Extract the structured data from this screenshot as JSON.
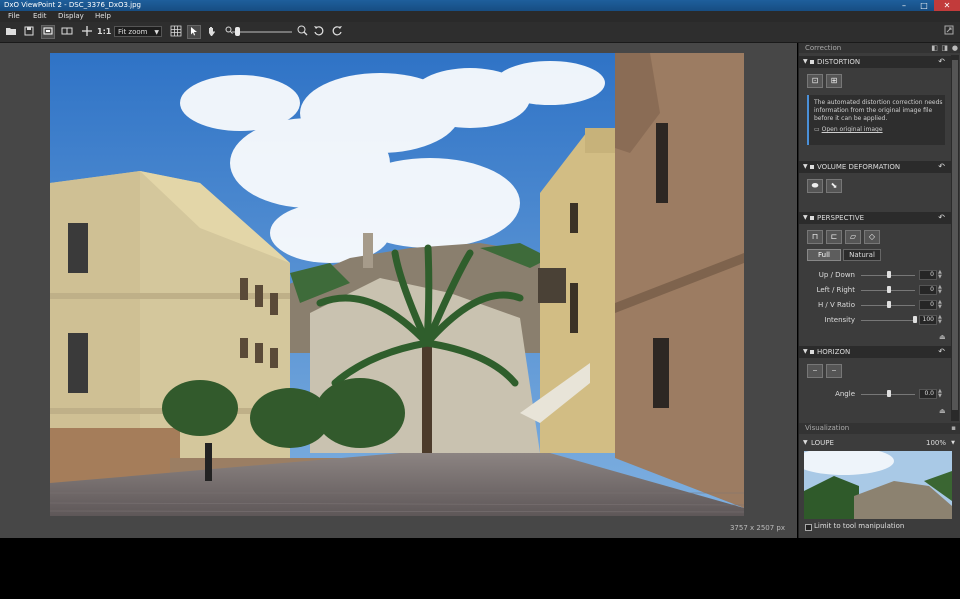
{
  "window": {
    "title": "DxO ViewPoint 2 - DSC_3376_DxO3.jpg",
    "minimize": "–",
    "maximize": "□",
    "close": "✕"
  },
  "menu": [
    "File",
    "Edit",
    "Display",
    "Help"
  ],
  "toolbar": {
    "one_to_one": "1:1",
    "zoom_select": "Fit zoom",
    "zoom_level": 0.05
  },
  "image": {
    "dimensions": "3757 x 2507 px"
  },
  "panel": {
    "title": "Correction",
    "distortion": {
      "title": "DISTORTION",
      "info": [
        "The automated distortion correction needs",
        "information from the original image file",
        "before it can be applied."
      ],
      "link": "Open original image"
    },
    "volume": {
      "title": "VOLUME DEFORMATION"
    },
    "perspective": {
      "title": "PERSPECTIVE",
      "mode_full": "Full",
      "mode_natural": "Natural",
      "sliders": [
        {
          "label": "Up / Down",
          "value": "0",
          "level": 0.5
        },
        {
          "label": "Left / Right",
          "value": "0",
          "level": 0.5
        },
        {
          "label": "H / V Ratio",
          "value": "0",
          "level": 0.5
        },
        {
          "label": "Intensity",
          "value": "100",
          "level": 1.0
        }
      ]
    },
    "horizon": {
      "title": "HORIZON",
      "slider": {
        "label": "Angle",
        "value": "0.0",
        "level": 0.5
      }
    },
    "visualization": {
      "title": "Visualization"
    },
    "loupe": {
      "title": "LOUPE",
      "zoom": "100%",
      "checkbox_label": "Limit to tool manipulation"
    }
  },
  "colors": {
    "title_bar": "#1e5f9c",
    "app_bg": "#474747",
    "panel_bg": "#3c3c3c"
  }
}
